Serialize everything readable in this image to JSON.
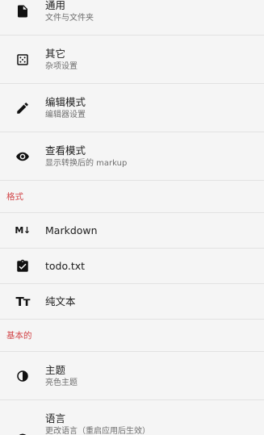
{
  "sections": {
    "top": [
      {
        "title": "通用",
        "subtitle": "文件与文件夹",
        "icon": "file-icon"
      },
      {
        "title": "其它",
        "subtitle": "杂项设置",
        "icon": "dice-icon"
      },
      {
        "title": "编辑模式",
        "subtitle": "编辑器设置",
        "icon": "pencil-icon"
      },
      {
        "title": "查看模式",
        "subtitle": "显示转换后的 markup",
        "icon": "eye-icon"
      }
    ],
    "format": {
      "header": "格式",
      "items": [
        {
          "title": "Markdown",
          "icon": "markdown-icon",
          "icon_text": "M↓"
        },
        {
          "title": "todo.txt",
          "icon": "clipboard-check-icon"
        },
        {
          "title": "纯文本",
          "icon": "text-format-icon",
          "icon_text": "Tт"
        }
      ]
    },
    "basic": {
      "header": "基本的",
      "items": [
        {
          "title": "主题",
          "subtitle": "亮色主题",
          "icon": "contrast-icon"
        },
        {
          "title": "语言",
          "subtitle": "更改语言（重启应用后生效）",
          "icon": "globe-icon"
        }
      ]
    }
  },
  "colors": {
    "background": "#f5f5f5",
    "section_header": "#d2474a",
    "divider": "#e2e2e2",
    "icon": "#111111"
  }
}
